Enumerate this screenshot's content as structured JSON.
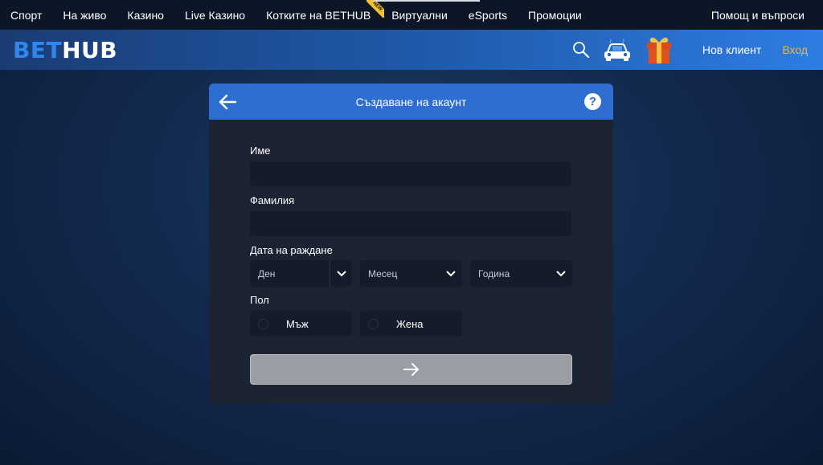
{
  "topnav": {
    "items": [
      "Спорт",
      "На живо",
      "Казино",
      "Live Казино",
      "Котките на BETHUB",
      "Виртуални",
      "eSports",
      "Промоции"
    ],
    "new_badge": "NEW",
    "help": "Помощ и въпроси"
  },
  "header": {
    "logo_part1": "BET",
    "logo_part2": "HUB",
    "new_client": "Нов клиент",
    "login": "Вход"
  },
  "modal": {
    "title": "Създаване на акаунт",
    "help_icon": "?",
    "fields": {
      "first_name_label": "Име",
      "first_name_value": "",
      "last_name_label": "Фамилия",
      "last_name_value": "",
      "birthdate_label": "Дата на раждане",
      "day_placeholder": "Ден",
      "month_placeholder": "Месец",
      "year_placeholder": "Година",
      "gender_label": "Пол",
      "male": "Мъж",
      "female": "Жена"
    }
  },
  "colors": {
    "accent_blue": "#2f6ed1",
    "login_gold": "#f2b43a",
    "modal_bg": "#1c2434",
    "input_bg": "#141b29",
    "submit_disabled": "#9a9da3"
  },
  "icons": [
    "search-icon",
    "car-icon",
    "gift-icon",
    "back-arrow-icon",
    "help-icon",
    "chevron-down-icon",
    "arrow-right-icon"
  ]
}
